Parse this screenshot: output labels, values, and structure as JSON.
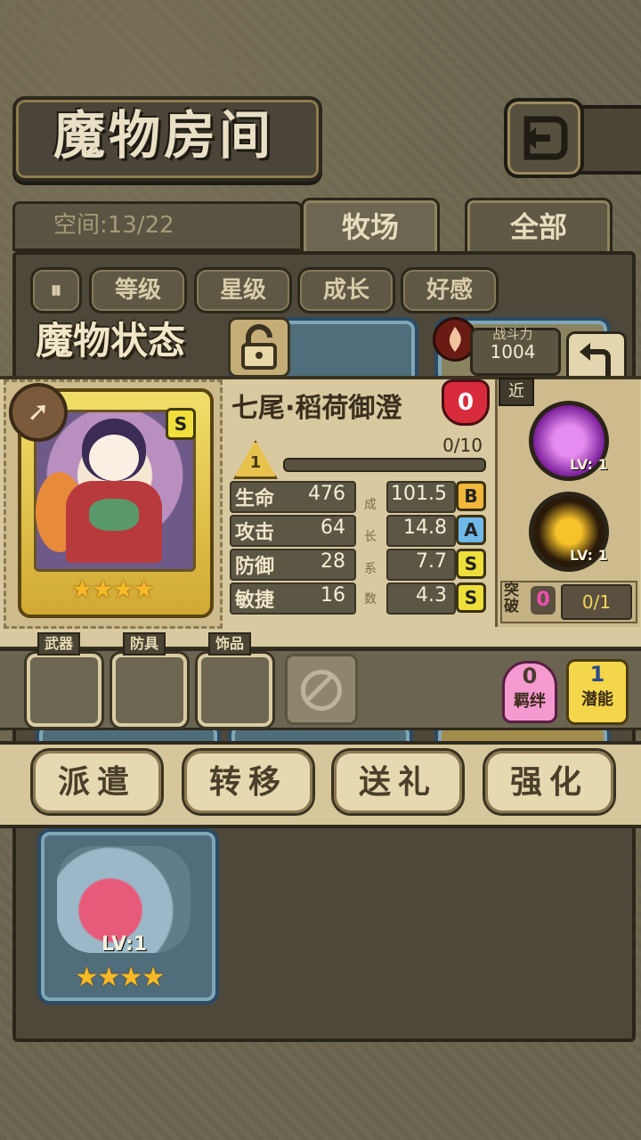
{
  "header": {
    "title": "魔物房间"
  },
  "tabs": {
    "space_label": "空间:13/22",
    "items": [
      {
        "label": "牧场"
      },
      {
        "label": "全部"
      }
    ]
  },
  "sort": {
    "buttons": [
      "等级",
      "星级",
      "成长",
      "好感"
    ]
  },
  "status": {
    "title": "魔物状态",
    "power_label": "战斗力",
    "power_value": "1004"
  },
  "monster": {
    "name": "七尾·稻荷御澄",
    "favor": "0",
    "rank": "S",
    "stars": "★★★★",
    "level": "1",
    "exp": "0/10",
    "stats": [
      {
        "label": "生命",
        "value": "476"
      },
      {
        "label": "攻击",
        "value": "64"
      },
      {
        "label": "防御",
        "value": "28"
      },
      {
        "label": "敏捷",
        "value": "16"
      }
    ],
    "growth_label_chars": [
      "成",
      "长",
      "系",
      "数"
    ],
    "growth": [
      {
        "value": "101.5",
        "grade": "B",
        "color": "#f2b63a"
      },
      {
        "value": "14.8",
        "grade": "A",
        "color": "#6fb8e8"
      },
      {
        "value": "7.7",
        "grade": "S",
        "color": "#eede3a"
      },
      {
        "value": "4.3",
        "grade": "S",
        "color": "#eede3a"
      }
    ],
    "attack_type": "近",
    "skills": [
      {
        "level": "LV: 1",
        "icon": "hearts-skill-icon"
      },
      {
        "level": "LV: 1",
        "icon": "fire-slash-skill-icon"
      }
    ],
    "breakthrough_label": "突破",
    "breakthrough_value": "0",
    "breakthrough_progress": "0/1"
  },
  "equipment": {
    "slots": [
      "武器",
      "防具",
      "饰品"
    ],
    "bond": {
      "value": "0",
      "label": "羁绊"
    },
    "potential": {
      "value": "1",
      "label": "潜能"
    }
  },
  "actions": [
    "派遣",
    "转移",
    "送礼",
    "强化"
  ],
  "bottom_card": {
    "level": "LV:1",
    "stars": "★★★★"
  },
  "colors": {
    "panel_bg": "#d8c9a0",
    "heart_red": "#d82b3c",
    "star_gold": "#f6b928"
  }
}
